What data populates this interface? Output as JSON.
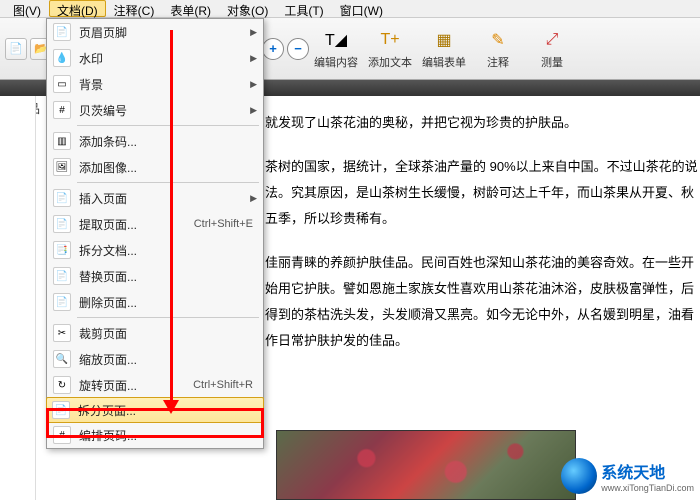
{
  "menubar": {
    "items": [
      "图(V)",
      "文档(D)",
      "注释(C)",
      "表单(R)",
      "对象(O)",
      "工具(T)",
      "窗口(W)"
    ]
  },
  "toolbar": {
    "edit_content": "编辑内容",
    "add_text": "添加文本",
    "edit_form": "编辑表单",
    "annotate": "注释",
    "measure": "测量"
  },
  "side_label": "容圣品",
  "dropdown": {
    "items": [
      {
        "label": "页眉页脚",
        "has_sub": true,
        "ico": "📄",
        "ico_name": "header-footer-icon"
      },
      {
        "label": "水印",
        "has_sub": true,
        "ico": "💧",
        "ico_name": "watermark-icon"
      },
      {
        "label": "背景",
        "has_sub": true,
        "ico": "▭",
        "ico_name": "background-icon"
      },
      {
        "label": "贝茨编号",
        "has_sub": true,
        "ico": "#",
        "ico_name": "bates-icon"
      },
      {
        "sep": true
      },
      {
        "label": "添加条码...",
        "ico": "▥",
        "ico_name": "barcode-icon"
      },
      {
        "label": "添加图像...",
        "ico": "🖼",
        "ico_name": "image-icon"
      },
      {
        "sep": true
      },
      {
        "label": "插入页面",
        "has_sub": true,
        "ico": "📄",
        "ico_name": "insert-page-icon"
      },
      {
        "label": "提取页面...",
        "shortcut": "Ctrl+Shift+E",
        "ico": "📄",
        "ico_name": "extract-page-icon"
      },
      {
        "label": "拆分文档...",
        "ico": "📑",
        "ico_name": "split-doc-icon"
      },
      {
        "label": "替换页面...",
        "ico": "📄",
        "ico_name": "replace-page-icon"
      },
      {
        "label": "删除页面...",
        "ico": "📄",
        "ico_name": "delete-page-icon"
      },
      {
        "sep": true
      },
      {
        "label": "裁剪页面",
        "ico": "✂",
        "ico_name": "crop-page-icon"
      },
      {
        "label": "缩放页面...",
        "ico": "🔍",
        "ico_name": "zoom-page-icon"
      },
      {
        "label": "旋转页面...",
        "shortcut": "Ctrl+Shift+R",
        "ico": "↻",
        "ico_name": "rotate-page-icon"
      },
      {
        "label": "拆分页面...",
        "hover": true,
        "ico": "📄",
        "ico_name": "split-page-icon"
      },
      {
        "label": "编排页码...",
        "ico": "#",
        "ico_name": "page-number-icon"
      }
    ]
  },
  "document": {
    "p1": "就发现了山茶花油的奥秘，并把它视为珍贵的护肤品。",
    "p2": "茶树的国家，据统计，全球茶油产量的 90%以上来自中国。不过山茶花的说法。究其原因，是山茶树生长缓慢，树龄可达上千年，而山茶果从开夏、秋五季，所以珍贵稀有。",
    "p3": "佳丽青睐的养颜护肤佳品。民间百姓也深知山茶花油的美容奇效。在一些开始用它护肤。譬如恩施土家族女性喜欢用山茶花油沐浴，皮肤极富弹性，后得到的茶枯洗头发，头发顺滑又黑亮。如今无论中外，从名媛到明星，油看作日常护肤护发的佳品。"
  },
  "logo": {
    "brand": "系统天地",
    "url": "www.xiTongTianDi.com"
  }
}
